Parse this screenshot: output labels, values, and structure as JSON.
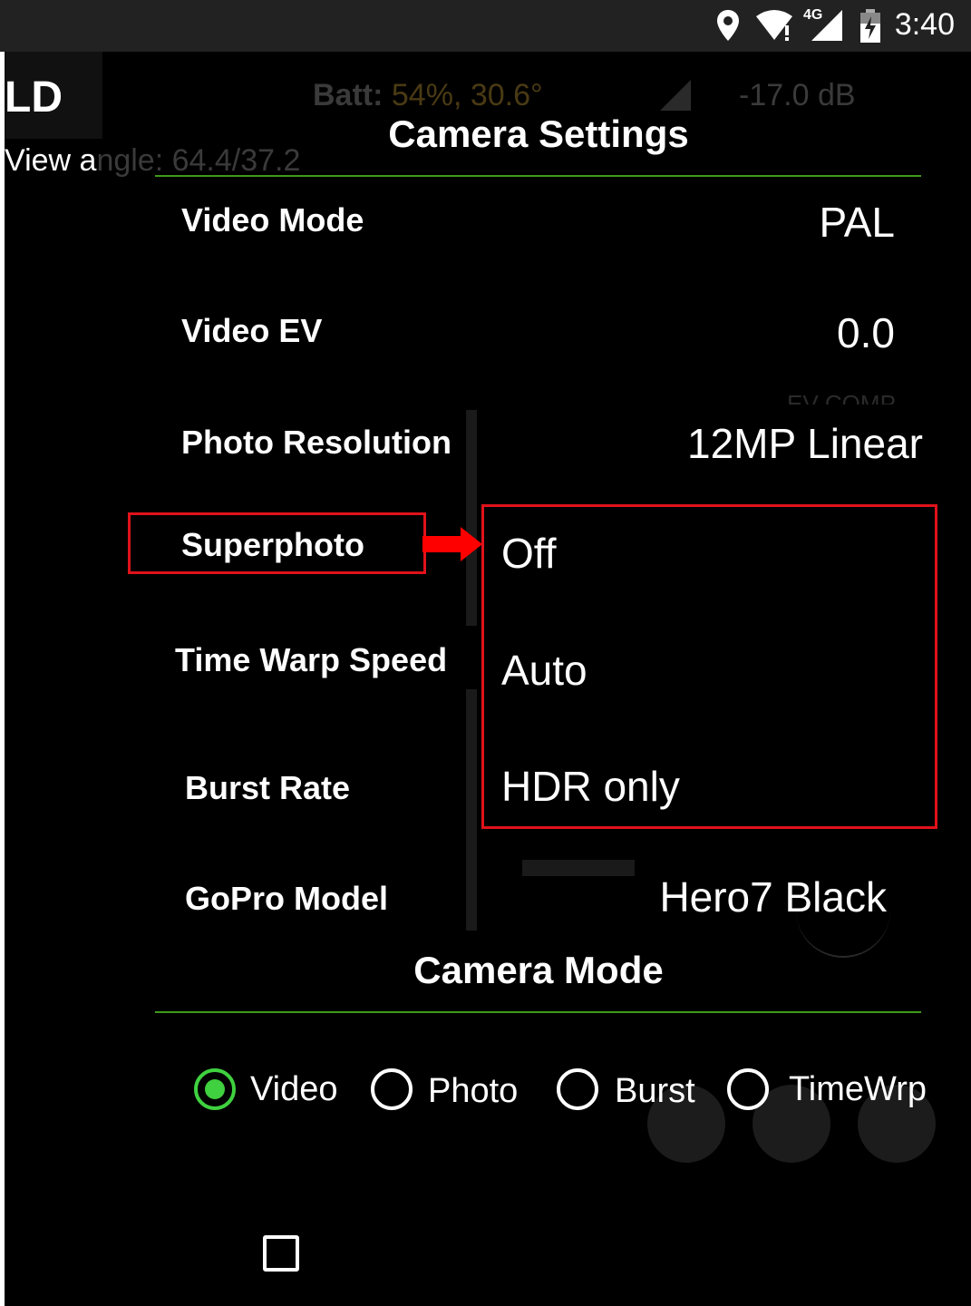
{
  "status_bar": {
    "time": "3:40",
    "network": "4G",
    "icons": [
      "location-icon",
      "wifi-icon",
      "cell-signal-icon",
      "battery-charging-icon"
    ]
  },
  "background": {
    "title_fragment": "LD",
    "view_angle_prefix": "View a",
    "view_angle_rest": "ngle: 64.4/37.2",
    "batt_label": "Batt:",
    "batt_value": "54%, 30.6°",
    "signal_db": "-17.0 dB",
    "ev_comp": "EV COMP"
  },
  "camera_settings": {
    "title": "Camera Settings",
    "rows": [
      {
        "label": "Video Mode",
        "value": "PAL"
      },
      {
        "label": "Video EV",
        "value": "0.0"
      },
      {
        "label": "Photo Resolution",
        "value": "12MP Linear"
      },
      {
        "label": "Superphoto",
        "value": ""
      },
      {
        "label": "Time Warp Speed",
        "value": ""
      },
      {
        "label": "Burst Rate",
        "value": ""
      },
      {
        "label": "GoPro Model",
        "value": "Hero7 Black"
      }
    ]
  },
  "superphoto_options": [
    "Off",
    "Auto",
    "HDR only"
  ],
  "camera_mode": {
    "title": "Camera Mode",
    "options": [
      "Video",
      "Photo",
      "Burst",
      "TimeWrp"
    ],
    "selected": "Video"
  },
  "colors": {
    "accent_green": "#3fd13f",
    "divider_green": "#3f9a1a",
    "annotation_red": "#e0121b"
  }
}
